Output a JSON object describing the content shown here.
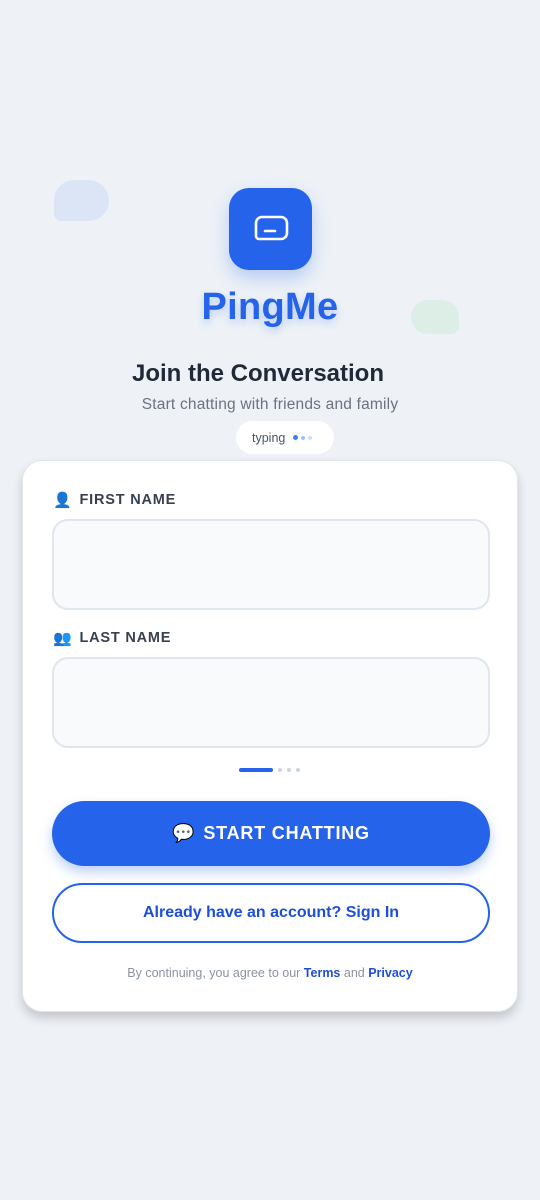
{
  "brand": {
    "name": "PingMe",
    "accent": "#2563eb",
    "logo_icon": "chat-bubble-icon"
  },
  "hero": {
    "headline": "Join the Conversation",
    "subheadline": "Start chatting with friends and family",
    "typing_label": "typing"
  },
  "form": {
    "first_name": {
      "icon": "👤",
      "label": "FIRST NAME",
      "value": "",
      "placeholder": ""
    },
    "last_name": {
      "icon": "👥",
      "label": "LAST NAME",
      "value": "",
      "placeholder": ""
    },
    "step_indicator": {
      "current": 1,
      "total": 4
    }
  },
  "actions": {
    "primary_icon": "💬",
    "primary_label": "START CHATTING",
    "secondary_label": "Already have an account? Sign In"
  },
  "legal": {
    "prefix": "By continuing, you agree to our",
    "terms": "Terms",
    "conjunction": "and",
    "privacy": "Privacy"
  }
}
